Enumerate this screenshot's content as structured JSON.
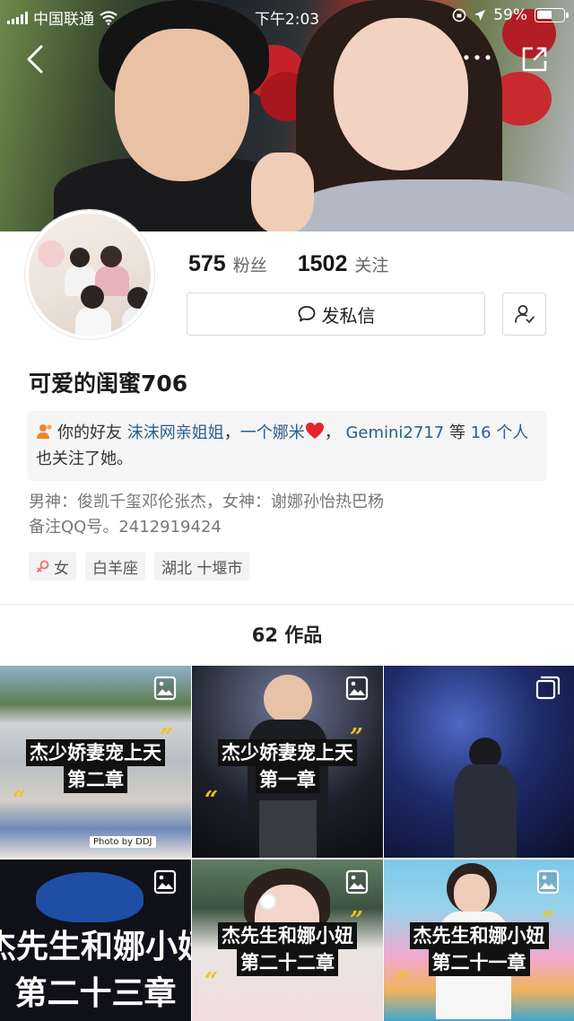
{
  "status_bar": {
    "carrier": "中国联通",
    "time": "下午2:03",
    "battery": "59%",
    "battery_level": 0.59
  },
  "profile": {
    "followers_count": "575",
    "followers_label": "粉丝",
    "following_count": "1502",
    "following_label": "关注",
    "message_button": "发私信",
    "nickname": "可爱的闺蜜706"
  },
  "mutual": {
    "prefix": "你的好友",
    "friend1": "沫沫网亲姐姐",
    "sep1": "，",
    "friend2": "一个娜米",
    "sep2": "，",
    "friend3": "Gemini2717",
    "middle": " 等 ",
    "count_link": "16 个人",
    "suffix": " 也关注了她。"
  },
  "bio": {
    "line1": "男神：俊凯千玺邓伦张杰，女神：谢娜孙怡热巴杨",
    "line2": "备注QQ号。2412919424"
  },
  "tags": {
    "gender": "女",
    "zodiac": "白羊座",
    "location": "湖北 十堰市"
  },
  "works": {
    "count_label": "62 作品",
    "items": [
      {
        "line1": "杰少娇妻宠上天",
        "line2": "第二章",
        "icon": "image-icon",
        "watermark": "Photo by DDJ"
      },
      {
        "line1": "杰少娇妻宠上天",
        "line2": "第一章",
        "icon": "image-icon"
      },
      {
        "icon": "gallery-icon"
      },
      {
        "line1": "杰先生和娜小妞",
        "line2": "第二十三章",
        "icon": "image-icon"
      },
      {
        "line1": "杰先生和娜小妞",
        "line2": "第二十二章",
        "icon": "image-icon"
      },
      {
        "line1": "杰先生和娜小妞",
        "line2": "第二十一章",
        "icon": "image-icon"
      }
    ]
  },
  "colors": {
    "link": "#2d5d8f",
    "quote_yellow": "#f3c21b",
    "friend_icon": "#f0852d"
  }
}
